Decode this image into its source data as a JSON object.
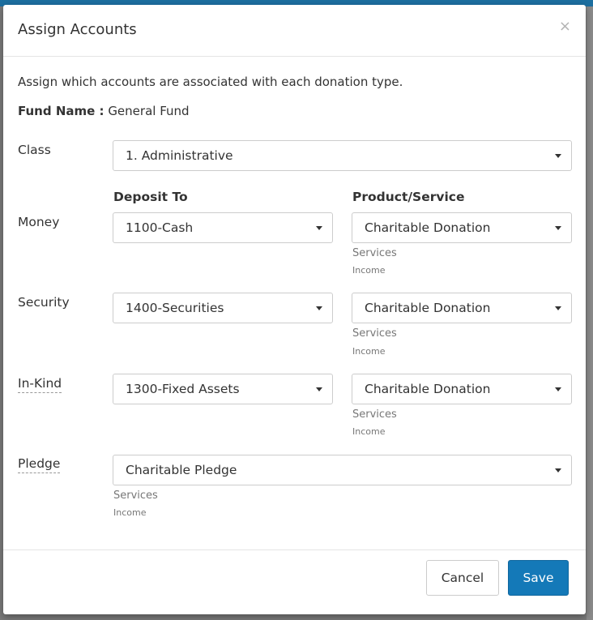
{
  "modal": {
    "title": "Assign Accounts",
    "close_symbol": "×",
    "description": "Assign which accounts are associated with each donation type.",
    "fund_label": "Fund Name :",
    "fund_value": "General Fund"
  },
  "class_row": {
    "label": "Class",
    "value": "1. Administrative"
  },
  "columns": {
    "deposit_to": "Deposit To",
    "product_service": "Product/Service"
  },
  "rows": [
    {
      "label": "Money",
      "deposit": "1100-Cash",
      "product": "Charitable Donation",
      "sub1": "Services",
      "sub2": "Income"
    },
    {
      "label": "Security",
      "deposit": "1400-Securities",
      "product": "Charitable Donation",
      "sub1": "Services",
      "sub2": "Income"
    },
    {
      "label": "In-Kind",
      "deposit": "1300-Fixed Assets",
      "product": "Charitable Donation",
      "sub1": "Services",
      "sub2": "Income"
    }
  ],
  "pledge_row": {
    "label": "Pledge",
    "value": "Charitable Pledge",
    "sub1": "Services",
    "sub2": "Income"
  },
  "footer": {
    "cancel_label": "Cancel",
    "save_label": "Save"
  },
  "colors": {
    "primary": "#1479b8",
    "header_bar": "#1d6fa0"
  }
}
